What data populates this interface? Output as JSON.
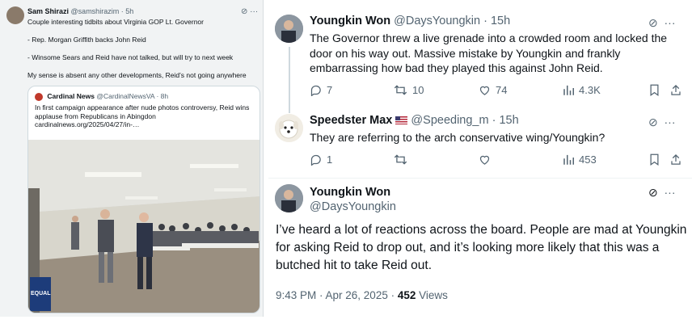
{
  "left_tweet": {
    "author_name": "Sam Shirazi",
    "author_handle": "@samshirazim",
    "time": "· 5h",
    "lines": [
      "Couple interesting tidbits about Virginia GOP Lt. Governor",
      "- Rep. Morgan Griffith backs John Reid",
      "- Winsome Sears and Reid have not talked, but will try to next week",
      "My sense is absent any other developments, Reid’s not going anywhere"
    ],
    "quote": {
      "author_name": "Cardinal News",
      "author_handle": "@CardinalNewsVA",
      "time": "· 8h",
      "text": "In first campaign appearance after nude photos controversy, Reid wins applause from Republicans in Abingdon cardinalnews.org/2025/04/27/in-…",
      "photo_sign": "EQUAL"
    }
  },
  "tweets": [
    {
      "author_name": "Youngkin Won",
      "author_handle": "@DaysYoungkin",
      "time": "· 15h",
      "text": "The Governor threw a live grenade into a crowded room and locked the door on his way out. Massive mistake by Youngkin and frankly embarrassing how bad they played this against John Reid.",
      "replies": "7",
      "reposts": "10",
      "likes": "74",
      "views": "4.3K"
    },
    {
      "author_name": "Speedster Max",
      "author_handle": "@Speeding_m",
      "time": "· 15h",
      "text": "They are referring to the arch conservative wing/Youngkin?",
      "replies": "1",
      "reposts": "",
      "likes": "",
      "views": "453"
    }
  ],
  "main_tweet": {
    "author_name": "Youngkin Won",
    "author_handle": "@DaysYoungkin",
    "text": "I’ve heard a lot of reactions across the board. People are mad at Youngkin for asking Reid to drop out, and it’s looking more likely that this was a butched hit to take Reid out.",
    "timestamp": "9:43 PM · Apr 26, 2025 · ",
    "views_count": "452",
    "views_label": " Views"
  },
  "colors": {
    "text": "#0f1419",
    "muted": "#536471",
    "border": "#eff3f4"
  },
  "icons": [
    "grok-icon",
    "more-icon",
    "reply-icon",
    "repost-icon",
    "like-icon",
    "views-icon",
    "bookmark-icon",
    "share-icon",
    "flag-us-icon"
  ]
}
